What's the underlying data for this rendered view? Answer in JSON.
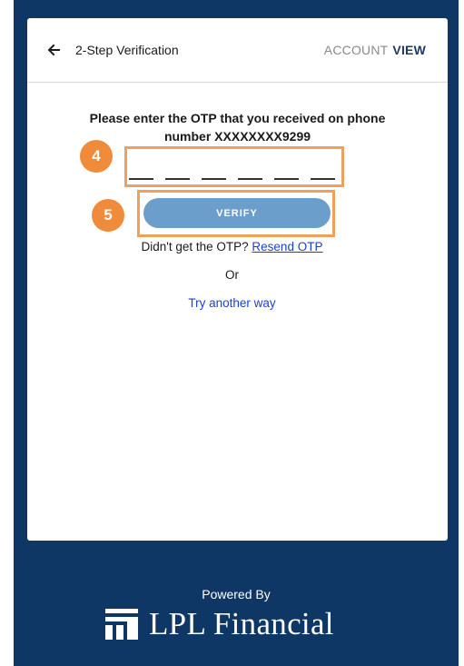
{
  "header": {
    "title": "2-Step Verification",
    "account_label": "ACCOUNT",
    "view_label": "VIEW"
  },
  "prompt": {
    "line1": "Please enter the OTP that you received on phone",
    "line2": "number XXXXXXXX9299"
  },
  "otp": {
    "slots": 6
  },
  "steps": {
    "otp_step": "4",
    "verify_step": "5"
  },
  "verify_label": "VERIFY",
  "resend": {
    "question": "Didn't get the OTP?",
    "link": "Resend OTP"
  },
  "or_text": "Or",
  "try_another_way": "Try another way",
  "footer": {
    "powered_by": "Powered By",
    "brand": "LPL Financial"
  },
  "colors": {
    "background": "#0e3765",
    "highlight": "#f0a05a",
    "badge": "#f08b3c",
    "button": "#6b9ecb",
    "link": "#1b3fd6"
  }
}
